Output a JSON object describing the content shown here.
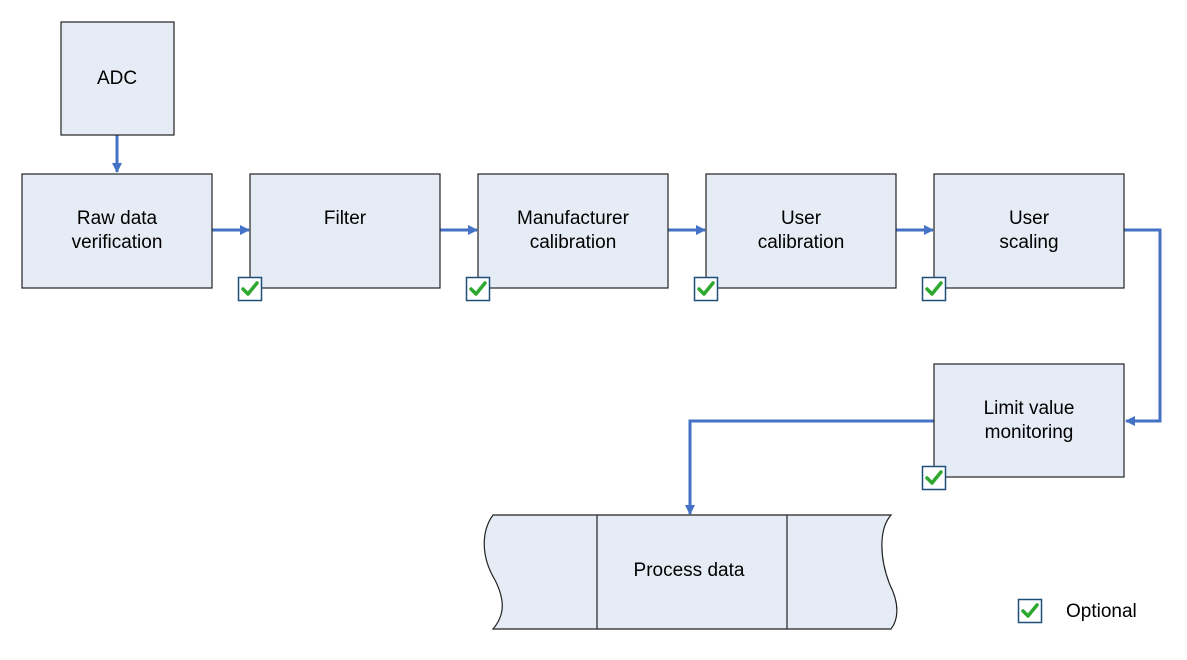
{
  "colors": {
    "box_fill": "#E6ECF6",
    "box_stroke": "#222222",
    "arrow": "#4472C4",
    "check": "#2EA82E",
    "checkbox_border": "#1F4E79"
  },
  "nodes": {
    "adc": {
      "label": [
        "ADC"
      ]
    },
    "raw": {
      "label": [
        "Raw data",
        "verification"
      ]
    },
    "filter": {
      "label": [
        "Filter"
      ],
      "optional": true
    },
    "mfr": {
      "label": [
        "Manufacturer",
        "calibration"
      ],
      "optional": true
    },
    "ucal": {
      "label": [
        "User",
        "calibration"
      ],
      "optional": true
    },
    "uscale": {
      "label": [
        "User",
        "scaling"
      ],
      "optional": true
    },
    "limit": {
      "label": [
        "Limit value",
        "monitoring"
      ],
      "optional": true
    },
    "process": {
      "label": [
        "Process data"
      ]
    }
  },
  "legend": {
    "icon": "checkbox-checked-icon",
    "label": "Optional"
  }
}
